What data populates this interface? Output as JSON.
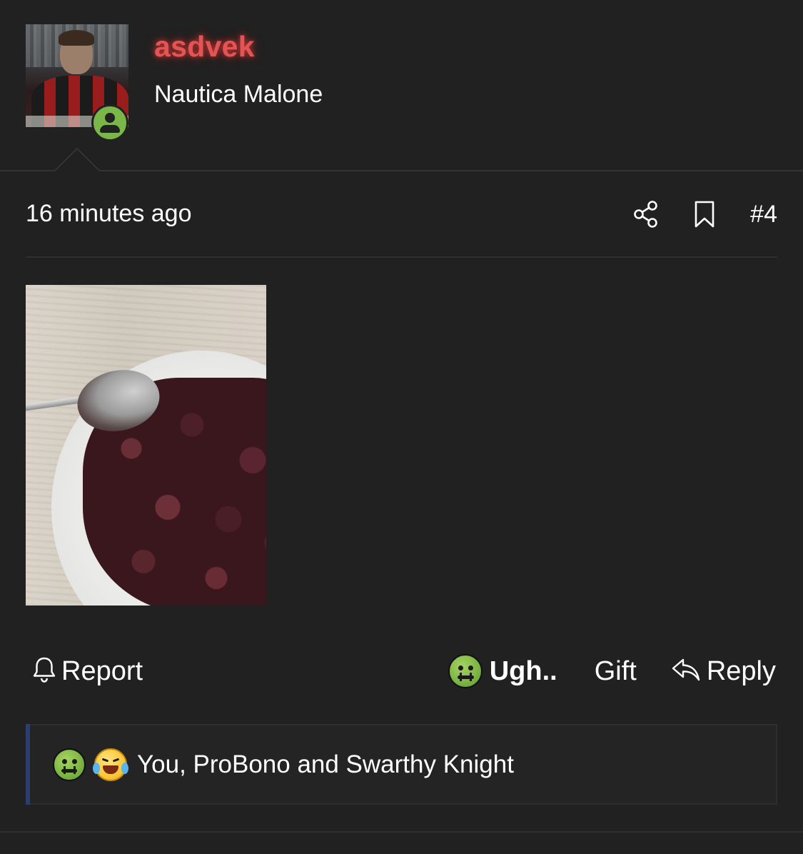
{
  "post": {
    "author": {
      "username": "asdvek",
      "user_title": "Nautica Malone",
      "status": "online",
      "username_color": "#e35454"
    },
    "meta": {
      "timestamp": "16 minutes ago",
      "post_number": "#4",
      "icons": [
        "share-icon",
        "bookmark-icon"
      ]
    },
    "attachment": {
      "type": "image",
      "alt": "photo"
    },
    "actions": {
      "report_label": "Report",
      "reaction_label": "Ugh..",
      "reaction_icon": "nauseated-face-icon",
      "gift_label": "Gift",
      "reply_label": "Reply"
    },
    "reactions_summary": {
      "icons": [
        "nauseated-face-icon",
        "crying-laughing-face-icon"
      ],
      "text": "You, ProBono and Swarthy Knight",
      "accent_color": "#2c3e6e"
    }
  }
}
